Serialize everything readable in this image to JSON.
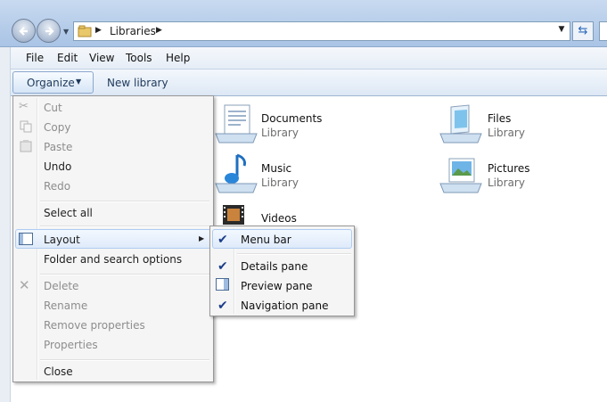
{
  "address": {
    "crumbs": [
      "Libraries"
    ]
  },
  "menubar": {
    "items": [
      "File",
      "Edit",
      "View",
      "Tools",
      "Help"
    ]
  },
  "commandbar": {
    "organize": "Organize",
    "new_library": "New library"
  },
  "libraries": [
    {
      "name": "Documents",
      "type": "Library",
      "icon": "documents-library-icon"
    },
    {
      "name": "Files",
      "type": "Library",
      "icon": "files-library-icon"
    },
    {
      "name": "Music",
      "type": "Library",
      "icon": "music-library-icon"
    },
    {
      "name": "Pictures",
      "type": "Library",
      "icon": "pictures-library-icon"
    },
    {
      "name": "Videos",
      "type": "",
      "icon": "videos-library-icon"
    }
  ],
  "organize_menu": {
    "cut": "Cut",
    "copy": "Copy",
    "paste": "Paste",
    "undo": "Undo",
    "redo": "Redo",
    "select_all": "Select all",
    "layout": "Layout",
    "folder_options": "Folder and search options",
    "delete": "Delete",
    "rename": "Rename",
    "remove_properties": "Remove properties",
    "properties": "Properties",
    "close": "Close"
  },
  "layout_submenu": {
    "menu_bar": {
      "label": "Menu bar",
      "checked": true
    },
    "details_pane": {
      "label": "Details pane",
      "checked": true
    },
    "preview_pane": {
      "label": "Preview pane",
      "checked": false
    },
    "navigation_pane": {
      "label": "Navigation pane",
      "checked": true
    }
  },
  "colors": {
    "accent": "#1e395b",
    "check": "#1b3d8a",
    "disabled": "#8d8d8d"
  }
}
